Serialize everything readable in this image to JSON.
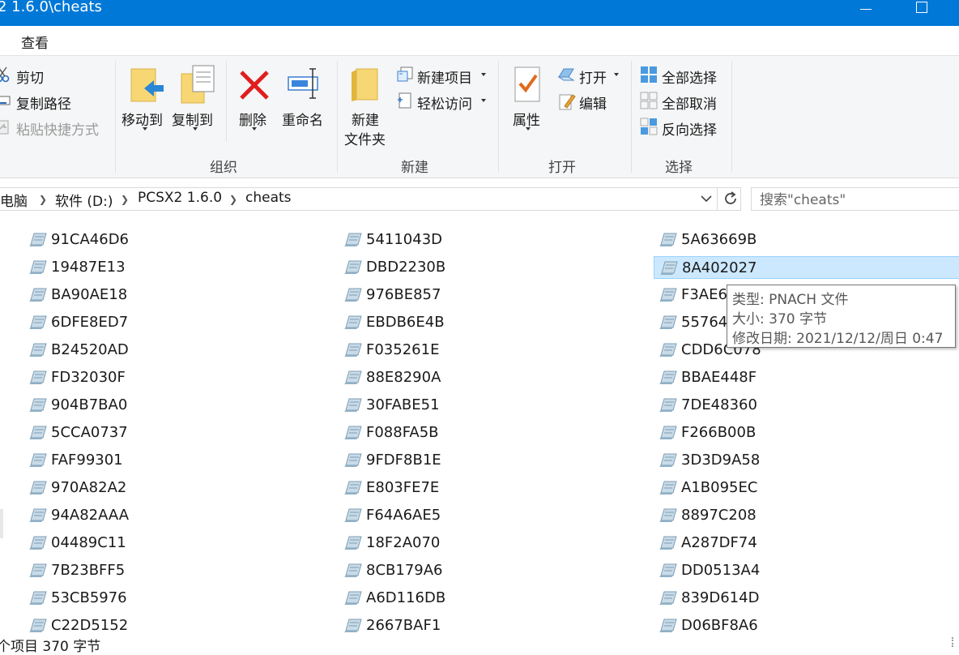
{
  "titlebar": {
    "title": "2 1.6.0\\cheats"
  },
  "ribbon_tab": "查看",
  "clipboard": {
    "cut": "剪切",
    "copy_path": "复制路径",
    "paste_shortcut": "粘贴快捷方式"
  },
  "organize": {
    "move_to": "移动到",
    "copy_to": "复制到",
    "delete": "删除",
    "rename": "重命名",
    "label": "组织"
  },
  "new": {
    "new_folder_line1": "新建",
    "new_folder_line2": "文件夹",
    "new_item": "新建项目",
    "easy_access": "轻松访问",
    "label": "新建"
  },
  "open": {
    "properties": "属性",
    "open": "打开",
    "edit": "编辑",
    "label": "打开"
  },
  "select": {
    "select_all": "全部选择",
    "select_none": "全部取消",
    "invert": "反向选择",
    "label": "选择"
  },
  "address": {
    "crumbs": [
      "电脑",
      "软件 (D:)",
      "PCSX2 1.6.0",
      "cheats"
    ],
    "search_placeholder": "搜索\"cheats\""
  },
  "files": {
    "col1": [
      "91CA46D6",
      "19487E13",
      "BA90AE18",
      "6DFE8ED7",
      "B24520AD",
      "FD32030F",
      "904B7BA0",
      "5CCA0737",
      "FAF99301",
      "970A82A2",
      "94A82AAA",
      "04489C11",
      "7B23BFF5",
      "53CB5976",
      "C22D5152"
    ],
    "col2": [
      "5411043D",
      "DBD2230B",
      "976BE857",
      "EBDB6E4B",
      "F035261E",
      "88E8290A",
      "30FABE51",
      "F088FA5B",
      "9FDF8B1E",
      "E803FE7E",
      "F64A6AE5",
      "18F2A070",
      "8CB179A6",
      "A6D116DB",
      "2667BAF1"
    ],
    "col3": [
      "5A63669B",
      "8A402027",
      "F3AE6",
      "55764",
      "CDD6C078",
      "BBAE448F",
      "7DE48360",
      "F266B00B",
      "3D3D9A58",
      "A1B095EC",
      "8897C208",
      "A287DF74",
      "DD0513A4",
      "839D614D",
      "D06BF8A6"
    ]
  },
  "tooltip": {
    "type": "类型: PNACH 文件",
    "size": "大小: 370 字节",
    "modified": "修改日期: 2021/12/12/周日 0:47"
  },
  "status": {
    "text": "个项目  370 字节"
  }
}
